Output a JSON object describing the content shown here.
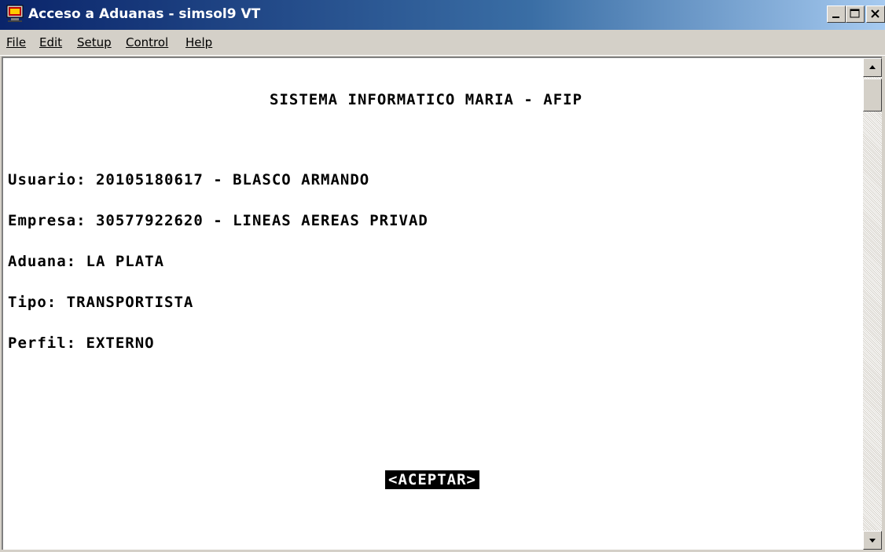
{
  "window": {
    "title": "Acceso a Aduanas - simsol9 VT",
    "icons": {
      "app": "terminal-app-icon",
      "minimize": "minimize-icon",
      "maximize": "maximize-icon",
      "close": "close-icon"
    }
  },
  "menu": [
    "File",
    "Edit",
    "Setup",
    "Control",
    "Help"
  ],
  "screen": {
    "header": "SISTEMA INFORMATICO MARIA - AFIP",
    "usuario": "Usuario: 20105180617 - BLASCO ARMANDO",
    "empresa": "Empresa: 30577922620 - LINEAS AEREAS PRIVAD",
    "aduana": "Aduana: LA PLATA",
    "tipo": "Tipo: TRANSPORTISTA",
    "perfil": "Perfil: EXTERNO",
    "accept_button": "<ACEPTAR>"
  },
  "colors": {
    "titlebar_start": "#0a246a",
    "titlebar_end": "#a6caf0",
    "chrome": "#d4d0c8",
    "terminal_bg": "#ffffff",
    "terminal_text": "#000000"
  }
}
